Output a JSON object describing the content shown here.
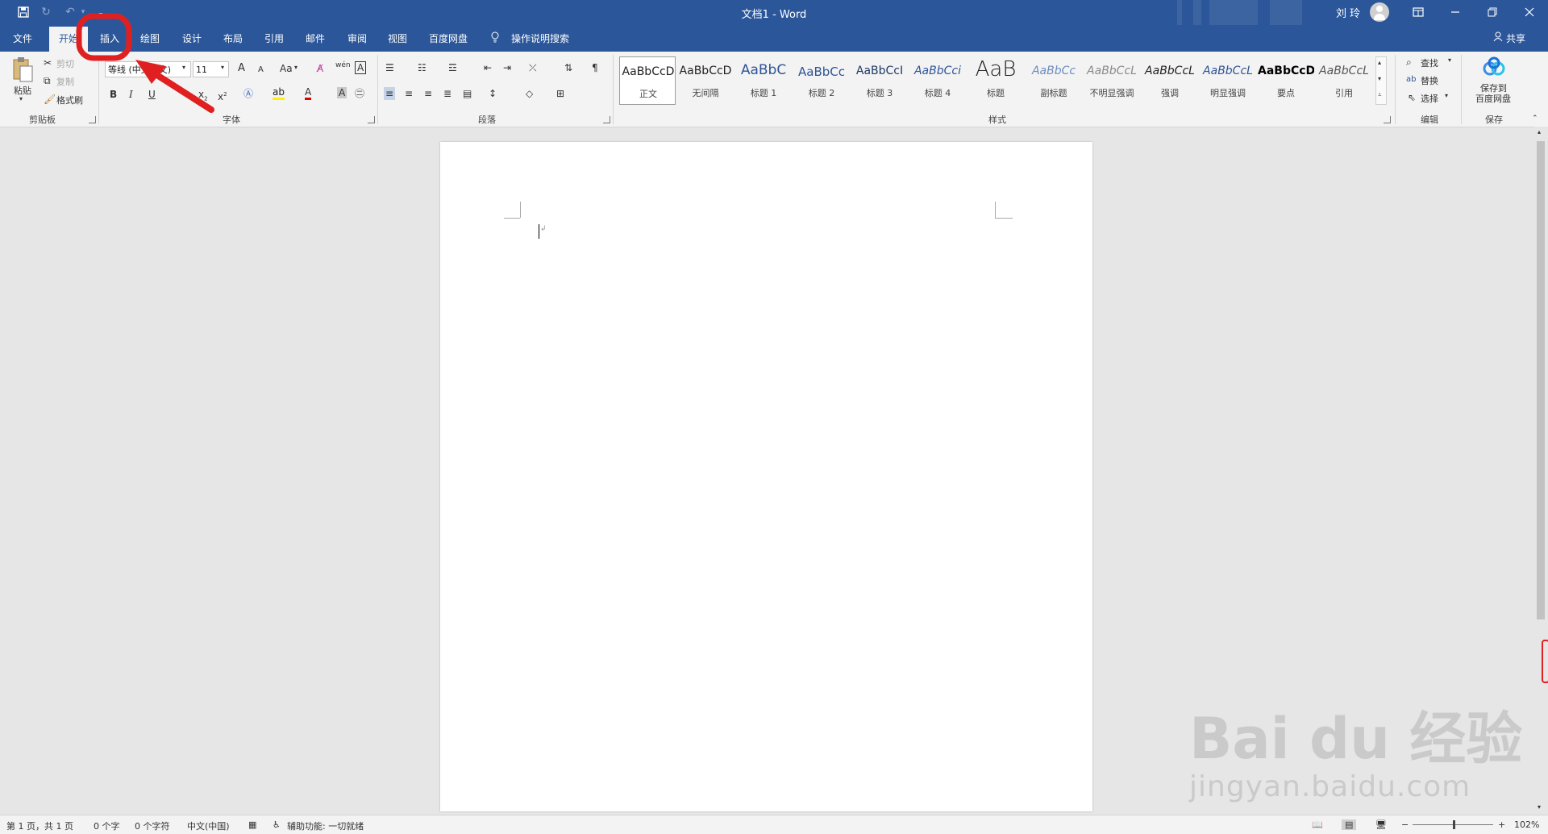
{
  "titlebar": {
    "title": "文档1  -  Word",
    "user": "刘 玲",
    "quick_access": {
      "save_icon": "save-icon",
      "autosave_icon": "autosave-icon",
      "undo_icon": "undo-icon",
      "customize_icon": "customize-qat-icon"
    },
    "window_controls": {
      "ribbon_display": "ribbon-display-icon",
      "minimize": "minimize-icon",
      "restore": "restore-icon",
      "close": "close-icon"
    }
  },
  "tabs": [
    {
      "label": "文件",
      "active": false
    },
    {
      "label": "开始",
      "active": true
    },
    {
      "label": "插入",
      "active": false
    },
    {
      "label": "绘图",
      "active": false
    },
    {
      "label": "设计",
      "active": false
    },
    {
      "label": "布局",
      "active": false
    },
    {
      "label": "引用",
      "active": false
    },
    {
      "label": "邮件",
      "active": false
    },
    {
      "label": "审阅",
      "active": false
    },
    {
      "label": "视图",
      "active": false
    },
    {
      "label": "百度网盘",
      "active": false
    }
  ],
  "tell_me": "操作说明搜索",
  "share": "共享",
  "clipboard": {
    "group": "剪贴板",
    "paste": "粘贴",
    "cut": "剪切",
    "copy": "复制",
    "format_painter": "格式刷"
  },
  "font": {
    "group": "字体",
    "name": "等线 (中文正文)",
    "size": "11",
    "grow": "A",
    "shrink": "A",
    "change_case": "Aa",
    "bold": "B",
    "italic": "I",
    "underline": "U",
    "subscript": "x",
    "superscript": "x",
    "font_color": "A",
    "phonetic": "wén",
    "char_border": "A"
  },
  "paragraph": {
    "group": "段落"
  },
  "styles": {
    "group": "样式",
    "items": [
      {
        "sample": "AaBbCcD",
        "name": "正文",
        "selected": true,
        "color": "#222222"
      },
      {
        "sample": "AaBbCcD",
        "name": "无间隔",
        "selected": false,
        "color": "#222222"
      },
      {
        "sample": "AaBbC",
        "name": "标题 1",
        "selected": false,
        "color": "#2f5496"
      },
      {
        "sample": "AaBbCc",
        "name": "标题 2",
        "selected": false,
        "color": "#2f5496"
      },
      {
        "sample": "AaBbCcI",
        "name": "标题 3",
        "selected": false,
        "color": "#1f3864"
      },
      {
        "sample": "AaBbCci",
        "name": "标题 4",
        "selected": false,
        "color": "#2f5496"
      },
      {
        "sample": "AaB",
        "name": "标题",
        "selected": false,
        "color": "#222222"
      },
      {
        "sample": "AaBbCc",
        "name": "副标题",
        "selected": false,
        "color": "#6d8cc0"
      },
      {
        "sample": "AaBbCcL",
        "name": "不明显强调",
        "selected": false,
        "color": "#8a8a8a"
      },
      {
        "sample": "AaBbCcL",
        "name": "强调",
        "selected": false,
        "color": "#222222"
      },
      {
        "sample": "AaBbCcL",
        "name": "明显强调",
        "selected": false,
        "color": "#2f5496"
      },
      {
        "sample": "AaBbCcD",
        "name": "要点",
        "selected": false,
        "color": "#000000"
      },
      {
        "sample": "AaBbCcL",
        "name": "引用",
        "selected": false,
        "color": "#555555"
      }
    ]
  },
  "editing": {
    "group": "编辑",
    "find": "查找",
    "replace": "替换",
    "select": "选择"
  },
  "save_group": {
    "group": "保存",
    "button_line1": "保存到",
    "button_line2": "百度网盘"
  },
  "status": {
    "page": "第 1 页，共 1 页",
    "words": "0 个字",
    "chars": "0 个字符",
    "language": "中文(中国)",
    "accessibility": "辅助功能: 一切就绪",
    "zoom": "102%"
  },
  "watermark": {
    "logo": "Bai du 经验",
    "url": "jingyan.baidu.com"
  },
  "colors": {
    "accent": "#2b579a",
    "annotation": "#e02020"
  }
}
